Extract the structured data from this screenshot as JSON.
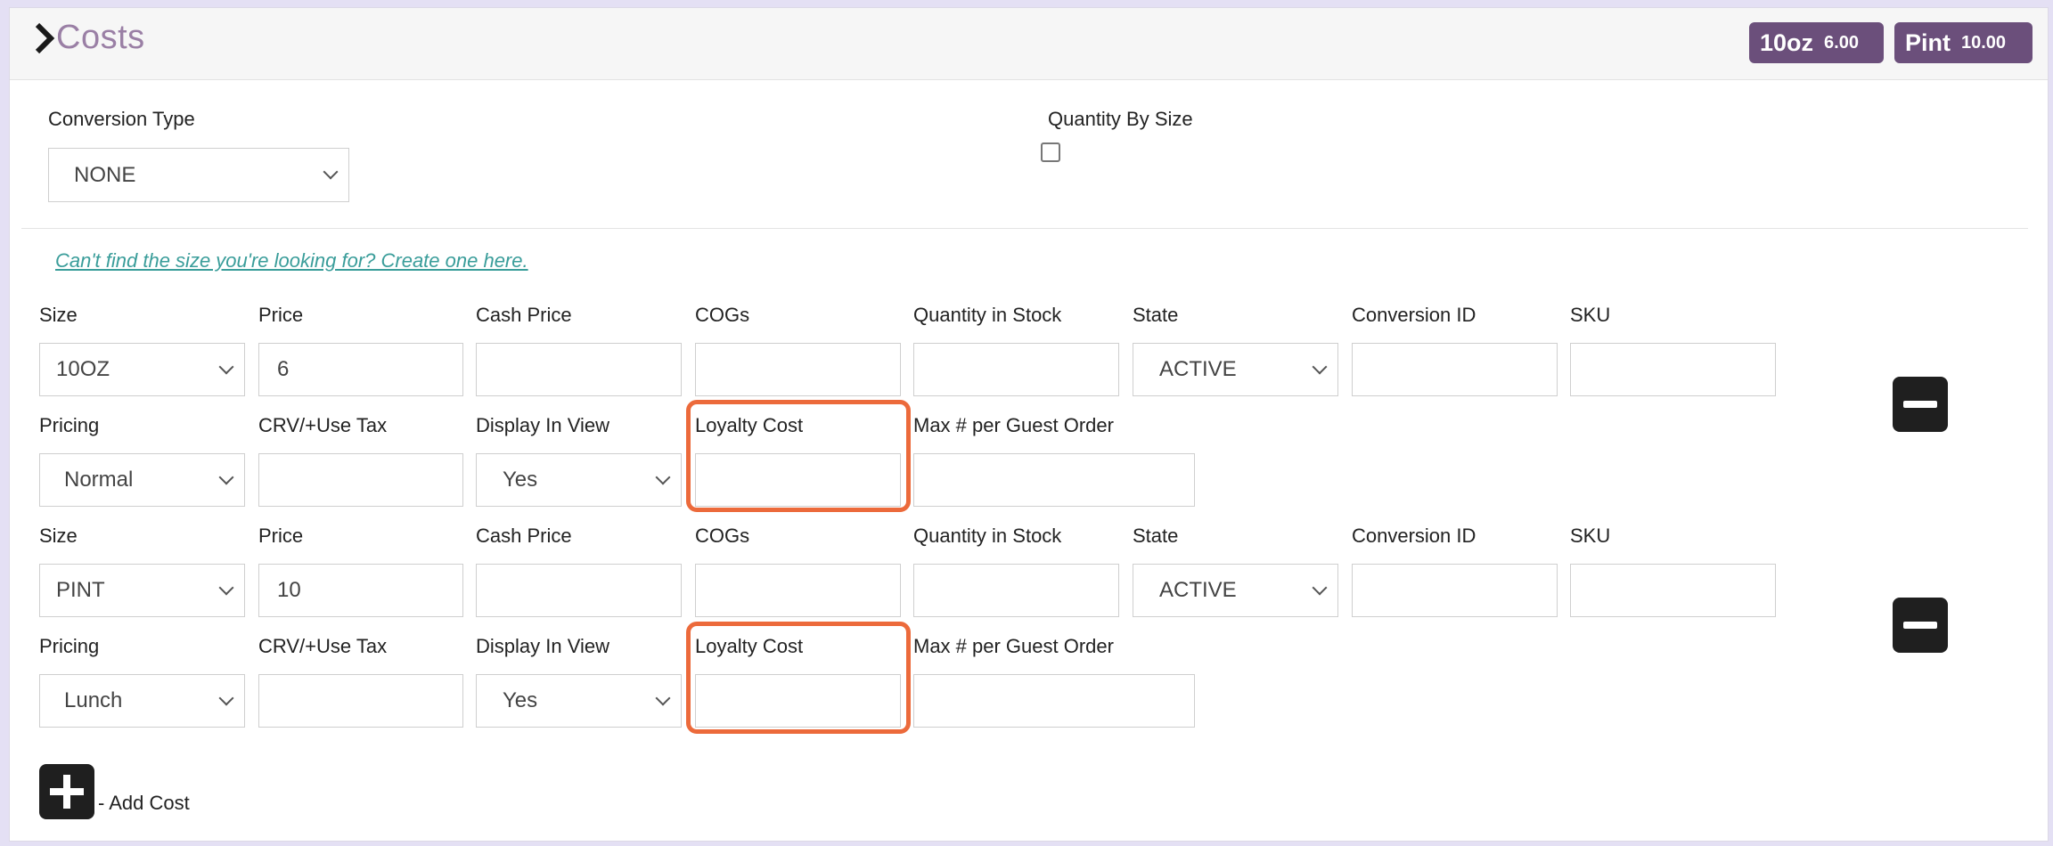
{
  "header": {
    "title": "Costs",
    "badges": [
      {
        "name": "10oz",
        "price": "6.00"
      },
      {
        "name": "Pint",
        "price": "10.00"
      }
    ]
  },
  "settings": {
    "conversion_type_label": "Conversion Type",
    "conversion_type_value": "NONE",
    "quantity_by_size_label": "Quantity By Size",
    "quantity_by_size_checked": false
  },
  "create_size_link": "Can't find the size you're looking for? Create one here.",
  "labels": {
    "size": "Size",
    "price": "Price",
    "cash_price": "Cash Price",
    "cogs": "COGs",
    "quantity_in_stock": "Quantity in Stock",
    "state": "State",
    "conversion_id": "Conversion ID",
    "sku": "SKU",
    "pricing": "Pricing",
    "crv": "CRV/+Use Tax",
    "display_in_view": "Display In View",
    "loyalty_cost": "Loyalty Cost",
    "max_per_guest": "Max # per Guest Order"
  },
  "costs": [
    {
      "size": "10OZ",
      "price": "6",
      "cash_price": "",
      "cogs": "",
      "quantity_in_stock": "",
      "state": "ACTIVE",
      "conversion_id": "",
      "sku": "",
      "pricing": "Normal",
      "crv": "",
      "display_in_view": "Yes",
      "loyalty_cost": "",
      "max_per_guest": ""
    },
    {
      "size": "PINT",
      "price": "10",
      "cash_price": "",
      "cogs": "",
      "quantity_in_stock": "",
      "state": "ACTIVE",
      "conversion_id": "",
      "sku": "",
      "pricing": "Lunch",
      "crv": "",
      "display_in_view": "Yes",
      "loyalty_cost": "",
      "max_per_guest": ""
    }
  ],
  "add_cost_label": "- Add Cost",
  "colors": {
    "badge": "#6b4f7b",
    "title": "#9a7fa5",
    "highlight": "#ec6a3b",
    "link": "#3a9d9a"
  }
}
